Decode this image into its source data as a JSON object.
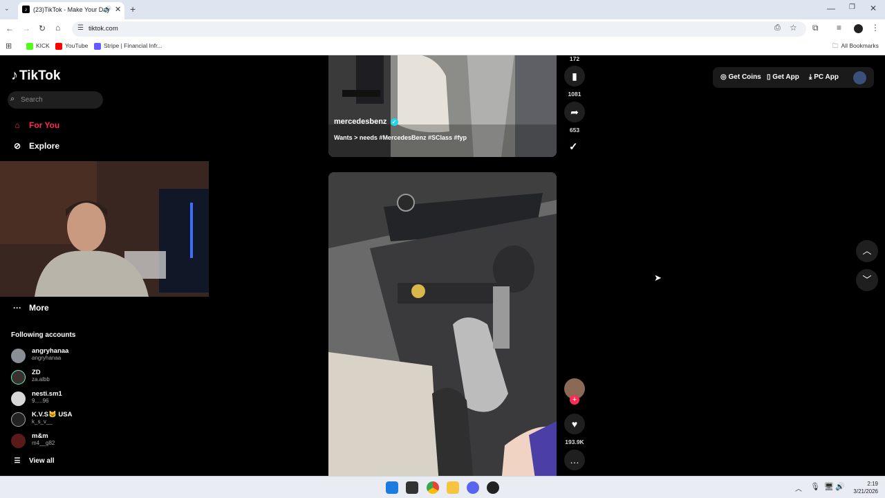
{
  "browser": {
    "tab_title": "(23)TikTok - Make Your Day",
    "url": "tiktok.com",
    "bookmarks": [
      {
        "label": "KICK",
        "color": "#53fc18"
      },
      {
        "label": "YouTube",
        "color": "#ff0000"
      },
      {
        "label": "Stripe | Financial Infr...",
        "color": "#635bff"
      }
    ],
    "all_bookmarks": "All Bookmarks"
  },
  "tiktok": {
    "logo": "TikTok",
    "search_placeholder": "Search",
    "nav": {
      "for_you": "For You",
      "explore": "Explore",
      "more": "More"
    },
    "following_header": "Following accounts",
    "accounts": [
      {
        "name": "angryhanaa",
        "handle": "angryhanaa"
      },
      {
        "name": "ZD",
        "handle": "za.albb"
      },
      {
        "name": "nesti.sm1",
        "handle": "9.....96"
      },
      {
        "name": "K.V.S🐱 USA",
        "handle": "k_s_v__"
      },
      {
        "name": "m&m",
        "handle": "m4__g82"
      }
    ],
    "view_all": "View all",
    "top_actions": {
      "get_coins": "Get Coins",
      "get_app": "Get App",
      "pc_app": "PC App"
    },
    "video1": {
      "author": "mercedesbenz",
      "caption": "Wants > needs #MercedesBenz #SClass #fyp",
      "count_top": "172",
      "saves": "1081",
      "shares": "653"
    },
    "video2": {
      "likes": "193.9K"
    },
    "accent_color": "#fe2c55"
  },
  "taskbar": {
    "time": "2:19",
    "date": "3/21/2026"
  }
}
